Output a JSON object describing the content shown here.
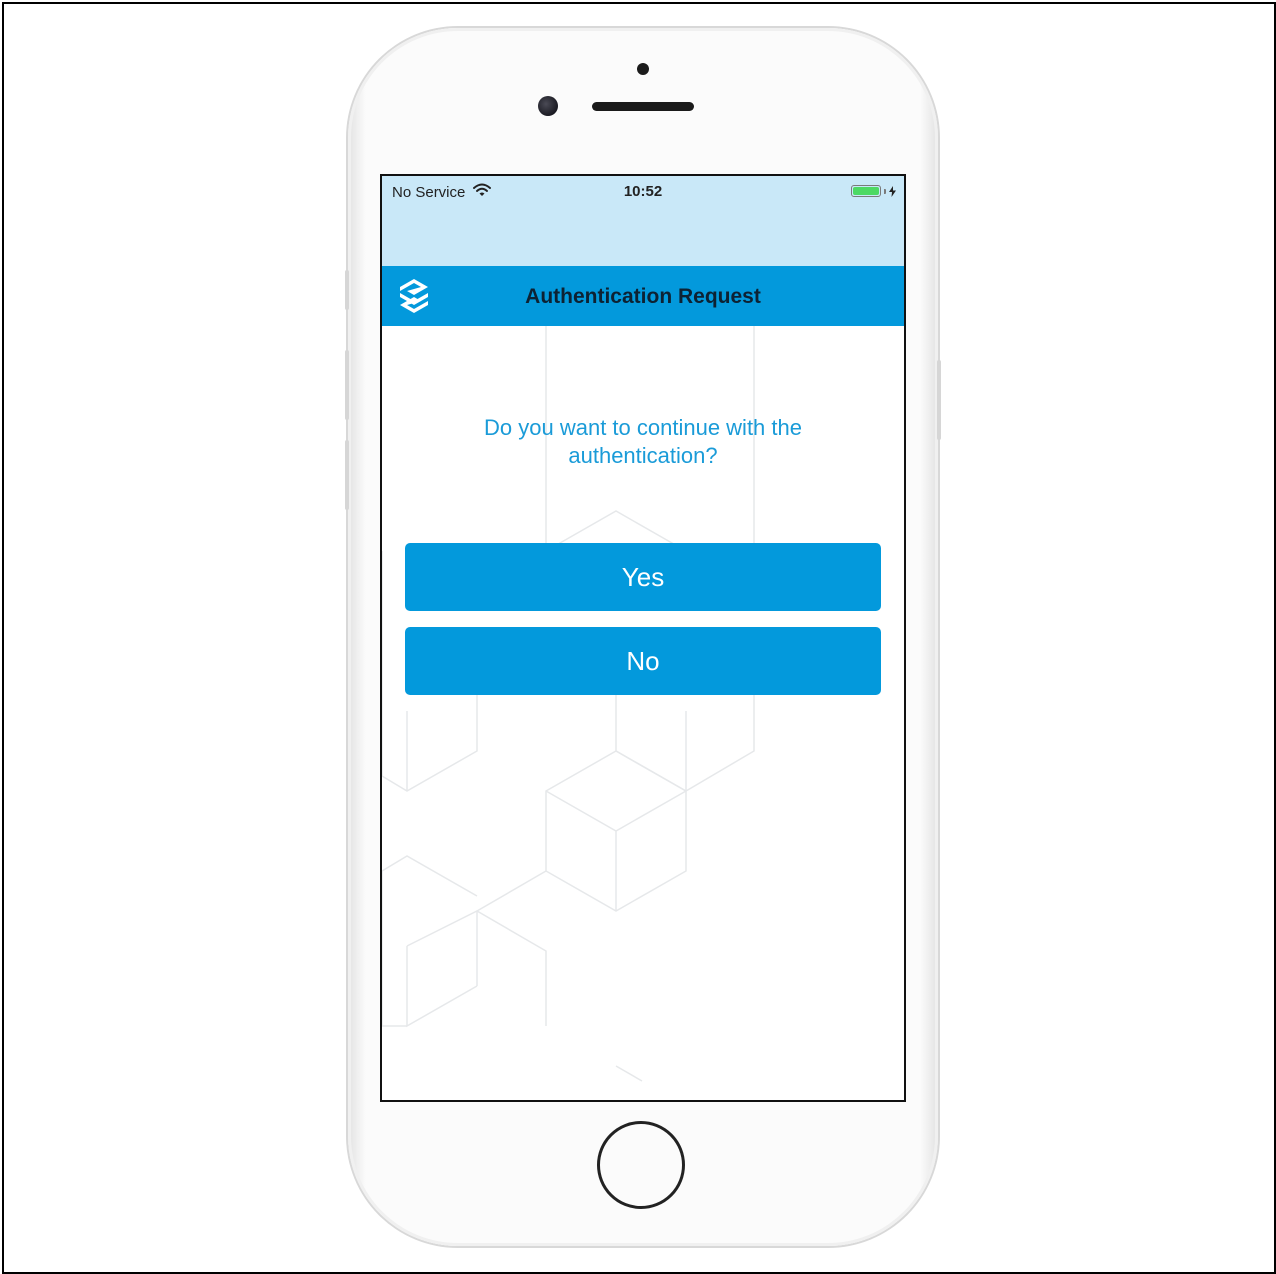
{
  "status_bar": {
    "carrier": "No Service",
    "time": "10:52",
    "wifi_icon": "wifi-icon",
    "battery_icon": "battery-charging-icon",
    "battery_level": 1.0,
    "battery_color": "#4cd964"
  },
  "app_bar": {
    "title": "Authentication Request",
    "logo_icon": "app-logo-icon",
    "color": "#0399dc"
  },
  "prompt": {
    "question": "Do you want to continue with the authentication?"
  },
  "actions": {
    "yes_label": "Yes",
    "no_label": "No",
    "button_color": "#0399dc"
  }
}
